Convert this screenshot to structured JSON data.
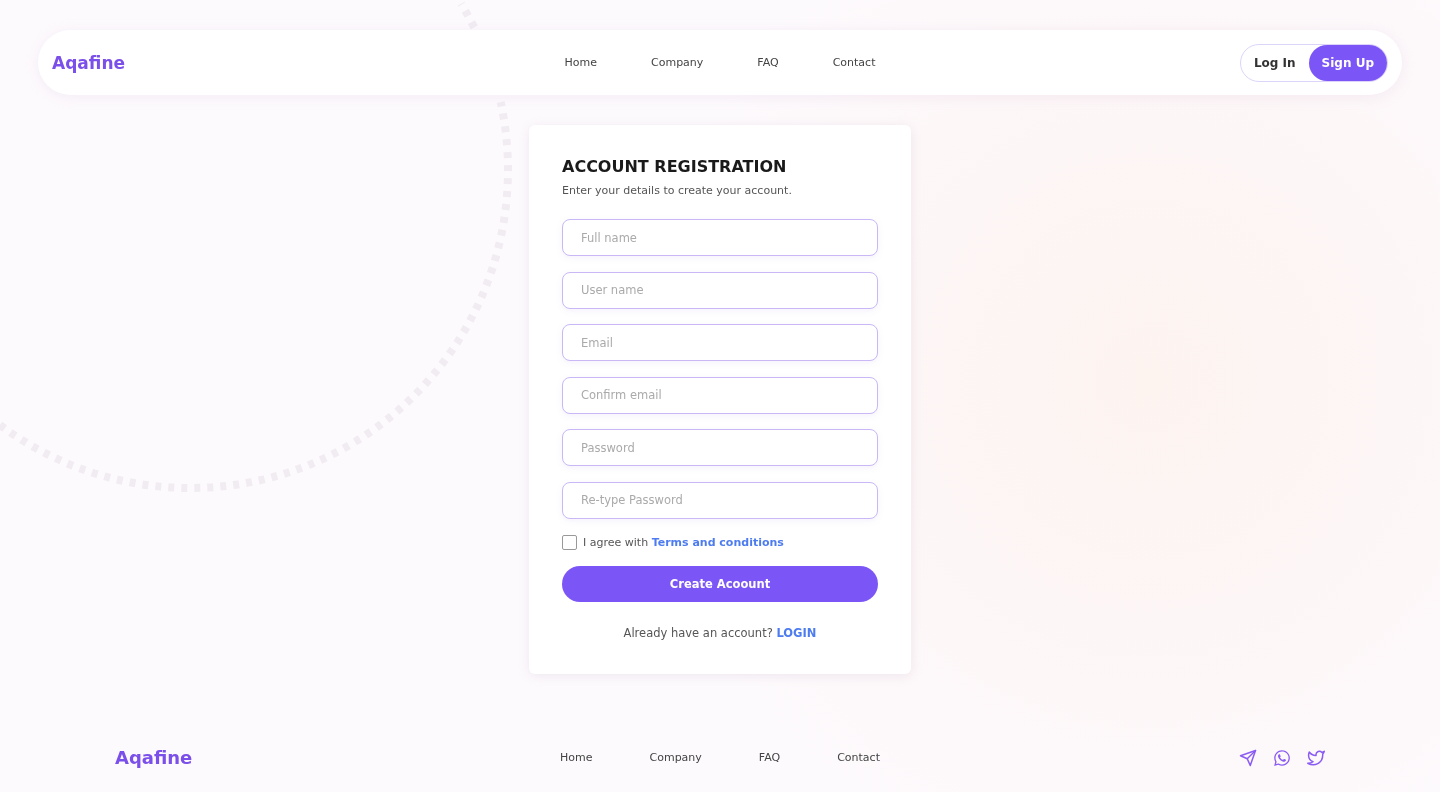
{
  "header": {
    "logo": "Aqafine",
    "nav": [
      "Home",
      "Company",
      "FAQ",
      "Contact"
    ],
    "auth": [
      {
        "label": "Log In",
        "selected": false
      },
      {
        "label": "Sign Up",
        "selected": true
      }
    ]
  },
  "form": {
    "title": "ACCOUNT REGISTRATION",
    "subtitle": "Enter your details to create your account.",
    "fields": [
      {
        "placeholder": "Full name"
      },
      {
        "placeholder": "User name"
      },
      {
        "placeholder": "Email"
      },
      {
        "placeholder": "Confirm email"
      },
      {
        "placeholder": "Password"
      },
      {
        "placeholder": "Re-type Password"
      }
    ],
    "agree": {
      "text": "I agree with",
      "link": "Terms and conditions",
      "checked": false
    },
    "submit": "Create Acoount",
    "login_prompt": {
      "text": "Already have an account?",
      "link": "LOGIN"
    }
  },
  "footer": {
    "logo": "Aqafine",
    "nav": [
      "Home",
      "Company",
      "FAQ",
      "Contact"
    ],
    "social": [
      {
        "kind": "telegram"
      },
      {
        "kind": "whatsapp"
      },
      {
        "kind": "twitter"
      }
    ]
  }
}
